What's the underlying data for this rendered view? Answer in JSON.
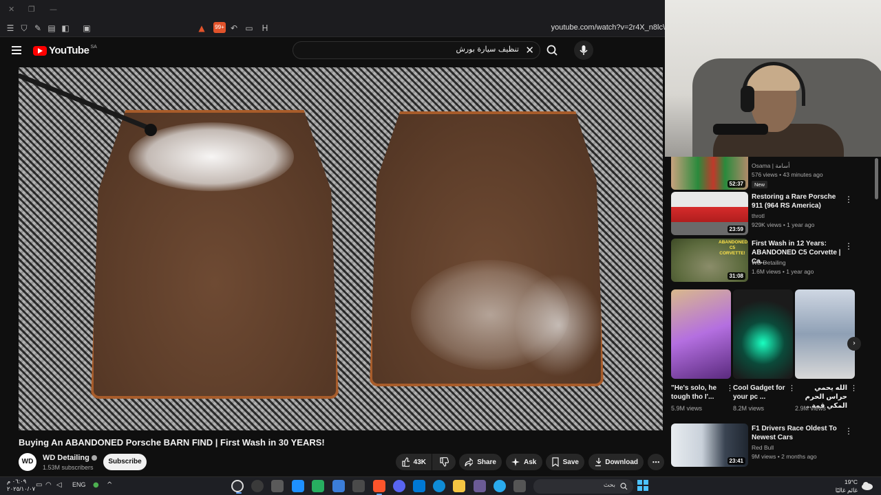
{
  "browser": {
    "url": "youtube.com/watch?v=2r4X_n8lc\\",
    "brave_badge": "99+"
  },
  "youtube": {
    "logo_text": "YouTube",
    "region": "SA",
    "search_value": "تنظيف سيارة بورش",
    "clear_icon": "✕"
  },
  "video": {
    "title": "Buying An ABANDONED Porsche BARN FIND | First Wash in 30 YEARS!",
    "channel": {
      "avatar_text": "WD",
      "name": "WD Detailing",
      "subscribers": "1.53M subscribers",
      "subscribe_label": "Subscribe"
    },
    "actions": {
      "likes": "43K",
      "share": "Share",
      "ask": "Ask",
      "save": "Save",
      "download": "Download"
    }
  },
  "sidebar": {
    "recommendations": [
      {
        "title": "",
        "channel": "Osama | أسامة",
        "meta": "576 views • 43 minutes ago",
        "badge": "New",
        "duration": "52:37"
      },
      {
        "title": "Restoring a Rare Porsche 911 (964 RS America)",
        "channel": "throtl",
        "meta": "929K views • 1 year ago",
        "duration": "23:59"
      },
      {
        "title": "First Wash in 12 Years: ABANDONED C5 Corvette | Ca...",
        "channel": "WD Detailing",
        "meta": "1.6M views • 1 year ago",
        "duration": "31:08",
        "thumb_text": "ABANDONED C5 CORVETTE!"
      },
      {
        "title": "F1 Drivers Race Oldest To Newest Cars",
        "channel": "Red Bull",
        "meta": "9M views • 2 months ago",
        "duration": "23:41"
      }
    ],
    "shorts": [
      {
        "title": "\"He's solo, he tough tho I'...",
        "views": "5.9M views"
      },
      {
        "title": "Cool Gadget for your pc ...",
        "views": "8.2M views"
      },
      {
        "title": "الله يحمي حراس الحرم المكي قمة...",
        "views": "2.9M views"
      }
    ],
    "next_icon": "›"
  },
  "taskbar": {
    "time": "٠٦:٠٩ م",
    "date": "٢٠٢٥/١٠/٠٧",
    "language": "ENG",
    "search_placeholder": "بحث",
    "weather_temp": "19°C",
    "weather_label": "غائم غالبًا"
  },
  "colors": {
    "background": "#0f0f0f",
    "youtube_red": "#ff0000",
    "pill_bg": "#272727",
    "mat_border": "#a85c2a"
  }
}
